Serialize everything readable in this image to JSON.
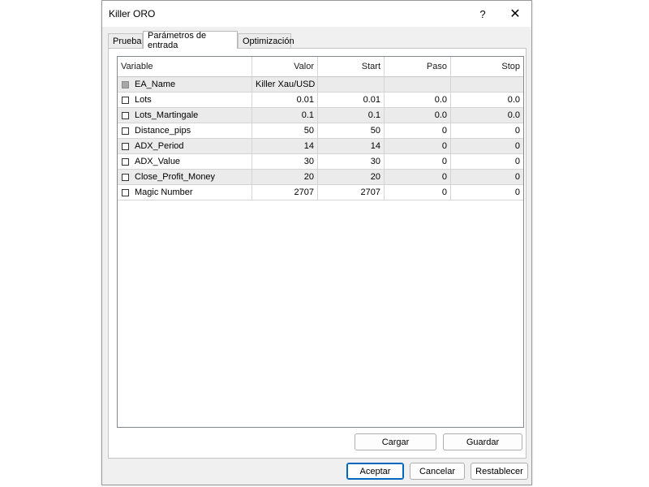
{
  "window": {
    "title": "Killer ORO",
    "help_glyph": "?",
    "close_glyph": "✕"
  },
  "tabs": [
    {
      "label": "Prueba"
    },
    {
      "label": "Parámetros de entrada"
    },
    {
      "label": "Optimización"
    }
  ],
  "grid": {
    "columns": [
      "Variable",
      "Valor",
      "Start",
      "Paso",
      "Stop"
    ],
    "rows": [
      {
        "name": "EA_Name",
        "valor": "Killer Xau/USD",
        "start": "",
        "paso": "",
        "stop": ""
      },
      {
        "name": "Lots",
        "valor": "0.01",
        "start": "0.01",
        "paso": "0.0",
        "stop": "0.0"
      },
      {
        "name": "Lots_Martingale",
        "valor": "0.1",
        "start": "0.1",
        "paso": "0.0",
        "stop": "0.0"
      },
      {
        "name": "Distance_pips",
        "valor": "50",
        "start": "50",
        "paso": "0",
        "stop": "0"
      },
      {
        "name": "ADX_Period",
        "valor": "14",
        "start": "14",
        "paso": "0",
        "stop": "0"
      },
      {
        "name": "ADX_Value",
        "valor": "30",
        "start": "30",
        "paso": "0",
        "stop": "0"
      },
      {
        "name": "Close_Profit_Money",
        "valor": "20",
        "start": "20",
        "paso": "0",
        "stop": "0"
      },
      {
        "name": "Magic Number",
        "valor": "2707",
        "start": "2707",
        "paso": "0",
        "stop": "0"
      }
    ]
  },
  "panel_buttons": {
    "cargar": "Cargar",
    "guardar": "Guardar"
  },
  "footer_buttons": {
    "aceptar": "Aceptar",
    "cancelar": "Cancelar",
    "restablecer": "Restablecer"
  },
  "colors": {
    "default_button_border": "#0067c0",
    "alt_row": "#ebebeb",
    "dialog_bg": "#f0f0f0"
  }
}
